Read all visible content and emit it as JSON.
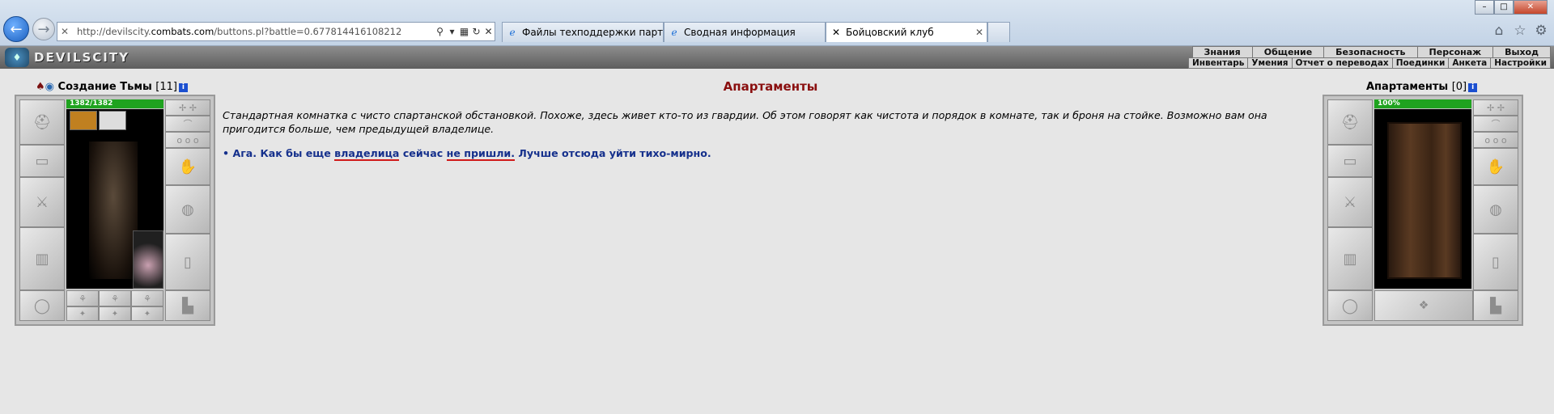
{
  "browser": {
    "address_url_prefix": "http://devilscity.",
    "address_url_domain": "combats.com",
    "address_url_path": "/buttons.pl?battle=0.677814416108212",
    "tabs": [
      {
        "label": "Файлы техподдержки партне..."
      },
      {
        "label": "Сводная информация"
      },
      {
        "label": "Бойцовский клуб"
      }
    ]
  },
  "game": {
    "logo_text": "DEVILSCITY",
    "menu_primary": [
      "Знания",
      "Общение",
      "Безопасность",
      "Персонаж",
      "Выход"
    ],
    "menu_secondary": [
      "Инвентарь",
      "Умения",
      "Отчет о переводах",
      "Поединки",
      "Анкета",
      "Настройки"
    ]
  },
  "player": {
    "name": "Создание Тьмы",
    "level": "[11]",
    "hp": "1382/1382",
    "hp_fraction": 1.0
  },
  "room_object": {
    "name": "Апартаменты",
    "level": "[0]",
    "hp": "100%",
    "hp_fraction": 1.0
  },
  "room": {
    "title": "Апартаменты",
    "description": "Стандартная комнатка с чисто спартанской обстановкой. Похоже, здесь живет кто-то из гвардии. Об этом говорят как чистота и порядок в комнате, так и броня на стойке. Возможно вам она пригодится больше, чем предыдущей владелице.",
    "action_bullet": "•",
    "action_parts": [
      "Ага. Как бы еще ",
      "владелица",
      " сейчас ",
      "не пришли.",
      " Лучше отсюда уйти тихо-мирно."
    ]
  },
  "colors": {
    "title": "#8a0f0f",
    "action": "#15308c",
    "hp": "#1fa31f",
    "underline": "#d01a1a"
  }
}
